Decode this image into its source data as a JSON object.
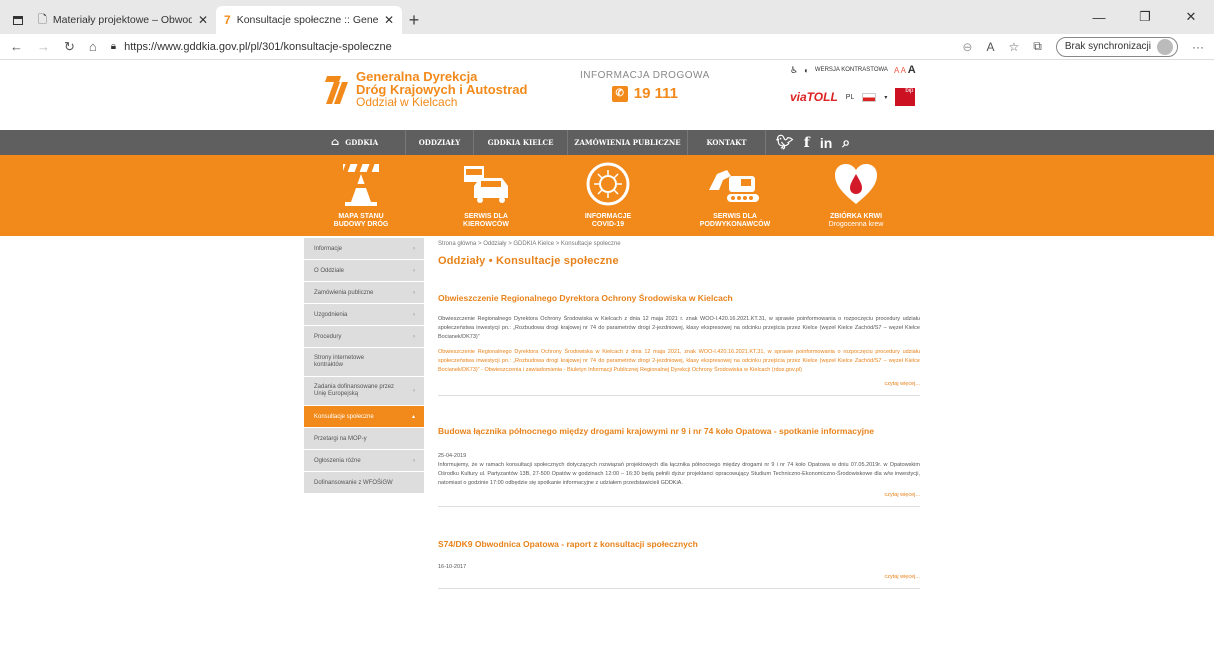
{
  "browser": {
    "tabs": [
      {
        "title": "Materiały projektowe – Obwodn",
        "active": false
      },
      {
        "title": "Konsultacje społeczne :: General",
        "active": true
      }
    ],
    "url": "https://www.gddkia.gov.pl/pl/301/konsultacje-spoleczne",
    "sync_label": "Brak synchronizacji"
  },
  "header": {
    "logo_line1": "Generalna Dyrekcja",
    "logo_line2": "Dróg Krajowych i Autostrad",
    "logo_line3": "Oddział w Kielcach",
    "info_label": "INFORMACJA DROGOWA",
    "info_number": "19 111",
    "contrast_label": "WERSJA KONTRASTOWA",
    "font_sizes": "A A",
    "font_size_large": "A",
    "viatoll": "viaTOLL",
    "lang": "PL",
    "bip": "bip"
  },
  "nav": {
    "items": [
      "GDDKIA",
      "ODDZIAŁY",
      "GDDKIA KIELCE",
      "ZAMÓWIENIA PUBLICZNE",
      "KONTAKT"
    ]
  },
  "banner": [
    {
      "l1": "MAPA STANU",
      "l2": "BUDOWY DRÓG"
    },
    {
      "l1": "SERWIS DLA",
      "l2": "KIEROWCÓW"
    },
    {
      "l1": "INFORMACJE",
      "l2": "COVID-19"
    },
    {
      "l1": "SERWIS DLA",
      "l2": "PODWYKONAWCÓW"
    },
    {
      "l1": "ZBIÓRKA KRWI",
      "l2": "Drogocenna krew"
    }
  ],
  "sidebar": [
    {
      "label": "Informacje",
      "arrow": "›"
    },
    {
      "label": "O Oddziale",
      "arrow": "›"
    },
    {
      "label": "Zamówienia publiczne",
      "arrow": "›"
    },
    {
      "label": "Uzgodnienia",
      "arrow": "›"
    },
    {
      "label": "Procedury",
      "arrow": "›"
    },
    {
      "label": "Strony internetowe kontraktów",
      "arrow": ""
    },
    {
      "label": "Zadania dofinansowane przez Unię Europejską",
      "arrow": "›"
    },
    {
      "label": "Konsultacje społeczne",
      "arrow": "▴",
      "active": true
    },
    {
      "label": "Przetargi na MOP-y",
      "arrow": ""
    },
    {
      "label": "Ogłoszenia różne",
      "arrow": "›"
    },
    {
      "label": "Dofinansowanie z WFOŚiGW",
      "arrow": ""
    }
  ],
  "breadcrumb": "Strona główna > Oddziały > GDDKIA Kielce > Konsultacje społeczne",
  "page_title": "Oddziały • Konsultacje społeczne",
  "articles": [
    {
      "title": "Obwieszczenie Regionalnego Dyrektora Ochrony Środowiska w Kielcach",
      "date": "",
      "body": "Obwieszczenie Regionalnego Dyrektora Ochrony Środowiska w Kielcach z dnia 12 maja 2021 r. znak WOO-I.420.16.2021.KT.31, w sprawie poinformowania o rozpoczęciu procedury udziału społeczeństwa inwestycji pn.: „Rozbudowa drogi krajowej nr 74 do parametrów drogi 2-jezdniowej, klasy ekspresowej na odcinku przejścia przez Kielce (węzeł Kielce Zachód/S7 – węzeł Kielce Bocianek/DK73)”",
      "body2": "Obwieszczenie Regionalnego Dyrektora Ochrony Środowiska w Kielcach z dnia 12 maja 2021, znak WOO-I.420.16.2021.KT.31, w sprawie poinformowania o rozpoczęciu procedury udziału społeczeństwa inwestycji pn.: „Rozbudowa drogi krajowej nr 74 do parametrów drogi 2-jezdniowej, klasy ekspresowej na odcinku przejścia przez Kielce (węzeł Kielce Zachód/S7 – węzeł Kielce Bocianek/DK73)” - Obwieszczenia i zawiadomienia - Biuletyn Informacji Publicznej Regionalnej Dyrekcji Ochrony Środowiska w Kielcach (rdos.gov.pl)",
      "more": "czytaj więcej..."
    },
    {
      "title": "Budowa łącznika północnego między drogami krajowymi nr 9 i nr 74 koło Opatowa - spotkanie informacyjne",
      "date": "25-04-2019",
      "body": "Informujemy, że w ramach konsultacji społecznych dotyczących rozwiązań projektowych dla łącznika północnego między drogami nr 9 i nr 74 koło Opatowa w dniu 07.05.2019r. w Opatowskim Ośrodku Kultury ul. Partyzantów 13B, 27-500 Opatów w godzinach 12:00 – 16:30 będą pełnili dyżur projektanci opracowujący Studium Techniczno-Ekonomiczno-Środowiskowe dla w/w inwestycji, natomiast o godzinie 17:00 odbędzie się spotkanie informacyjne z udziałem przedstawicieli GDDKiA.",
      "body2": "",
      "more": "czytaj więcej..."
    },
    {
      "title": "S74/DK9 Obwodnica Opatowa - raport z konsultacji społecznych",
      "date": "16-10-2017",
      "body": "",
      "body2": "",
      "more": "czytaj więcej..."
    }
  ],
  "colors": {
    "accent": "#f28a1b",
    "nav": "#5f5f5f",
    "sidebar": "#dddddd"
  }
}
